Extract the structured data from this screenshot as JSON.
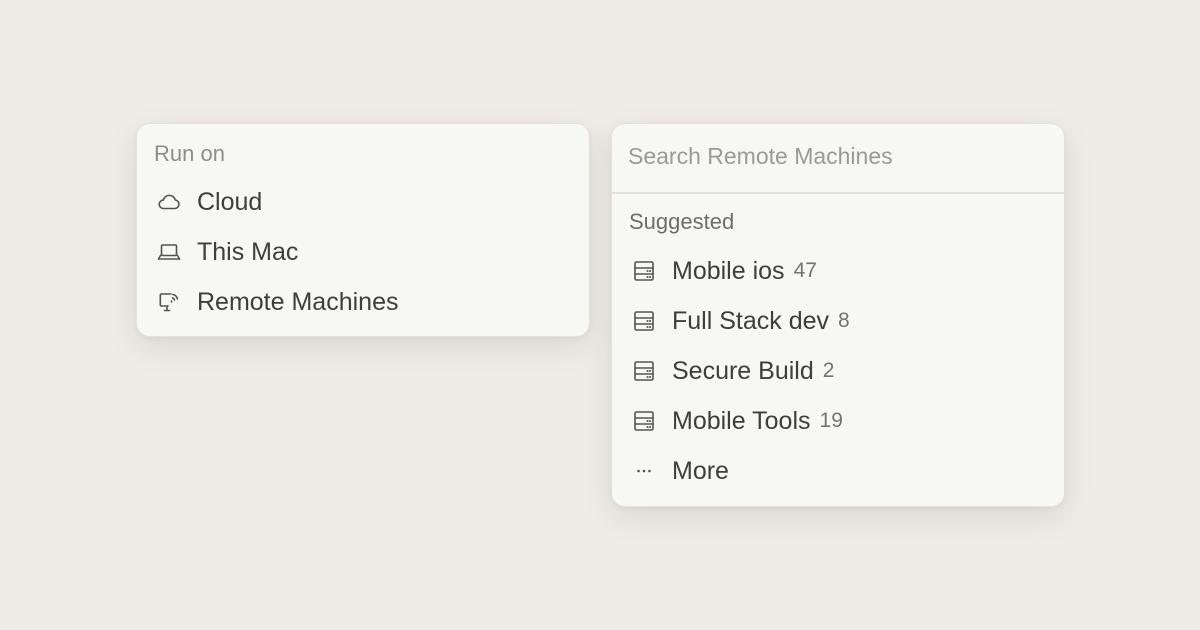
{
  "run_on": {
    "header": "Run on",
    "items": [
      {
        "label": "Cloud",
        "icon": "cloud-icon"
      },
      {
        "label": "This Mac",
        "icon": "laptop-icon"
      },
      {
        "label": "Remote Machines",
        "icon": "remote-desktop-icon"
      }
    ]
  },
  "remote": {
    "search_placeholder": "Search Remote Machines",
    "search_value": "",
    "suggested_header": "Suggested",
    "machines": [
      {
        "name": "Mobile ios",
        "count": "47",
        "icon": "server-icon"
      },
      {
        "name": "Full Stack dev",
        "count": "8",
        "icon": "server-icon"
      },
      {
        "name": "Secure Build",
        "count": "2",
        "icon": "server-icon"
      },
      {
        "name": "Mobile Tools",
        "count": "19",
        "icon": "server-icon"
      }
    ],
    "more_label": "More",
    "more_icon": "more-dots-icon"
  },
  "colors": {
    "background": "#efebe5",
    "panel": "#f7f7f4",
    "text": "#3f3e3b",
    "muted_text": "#8f8d88"
  }
}
